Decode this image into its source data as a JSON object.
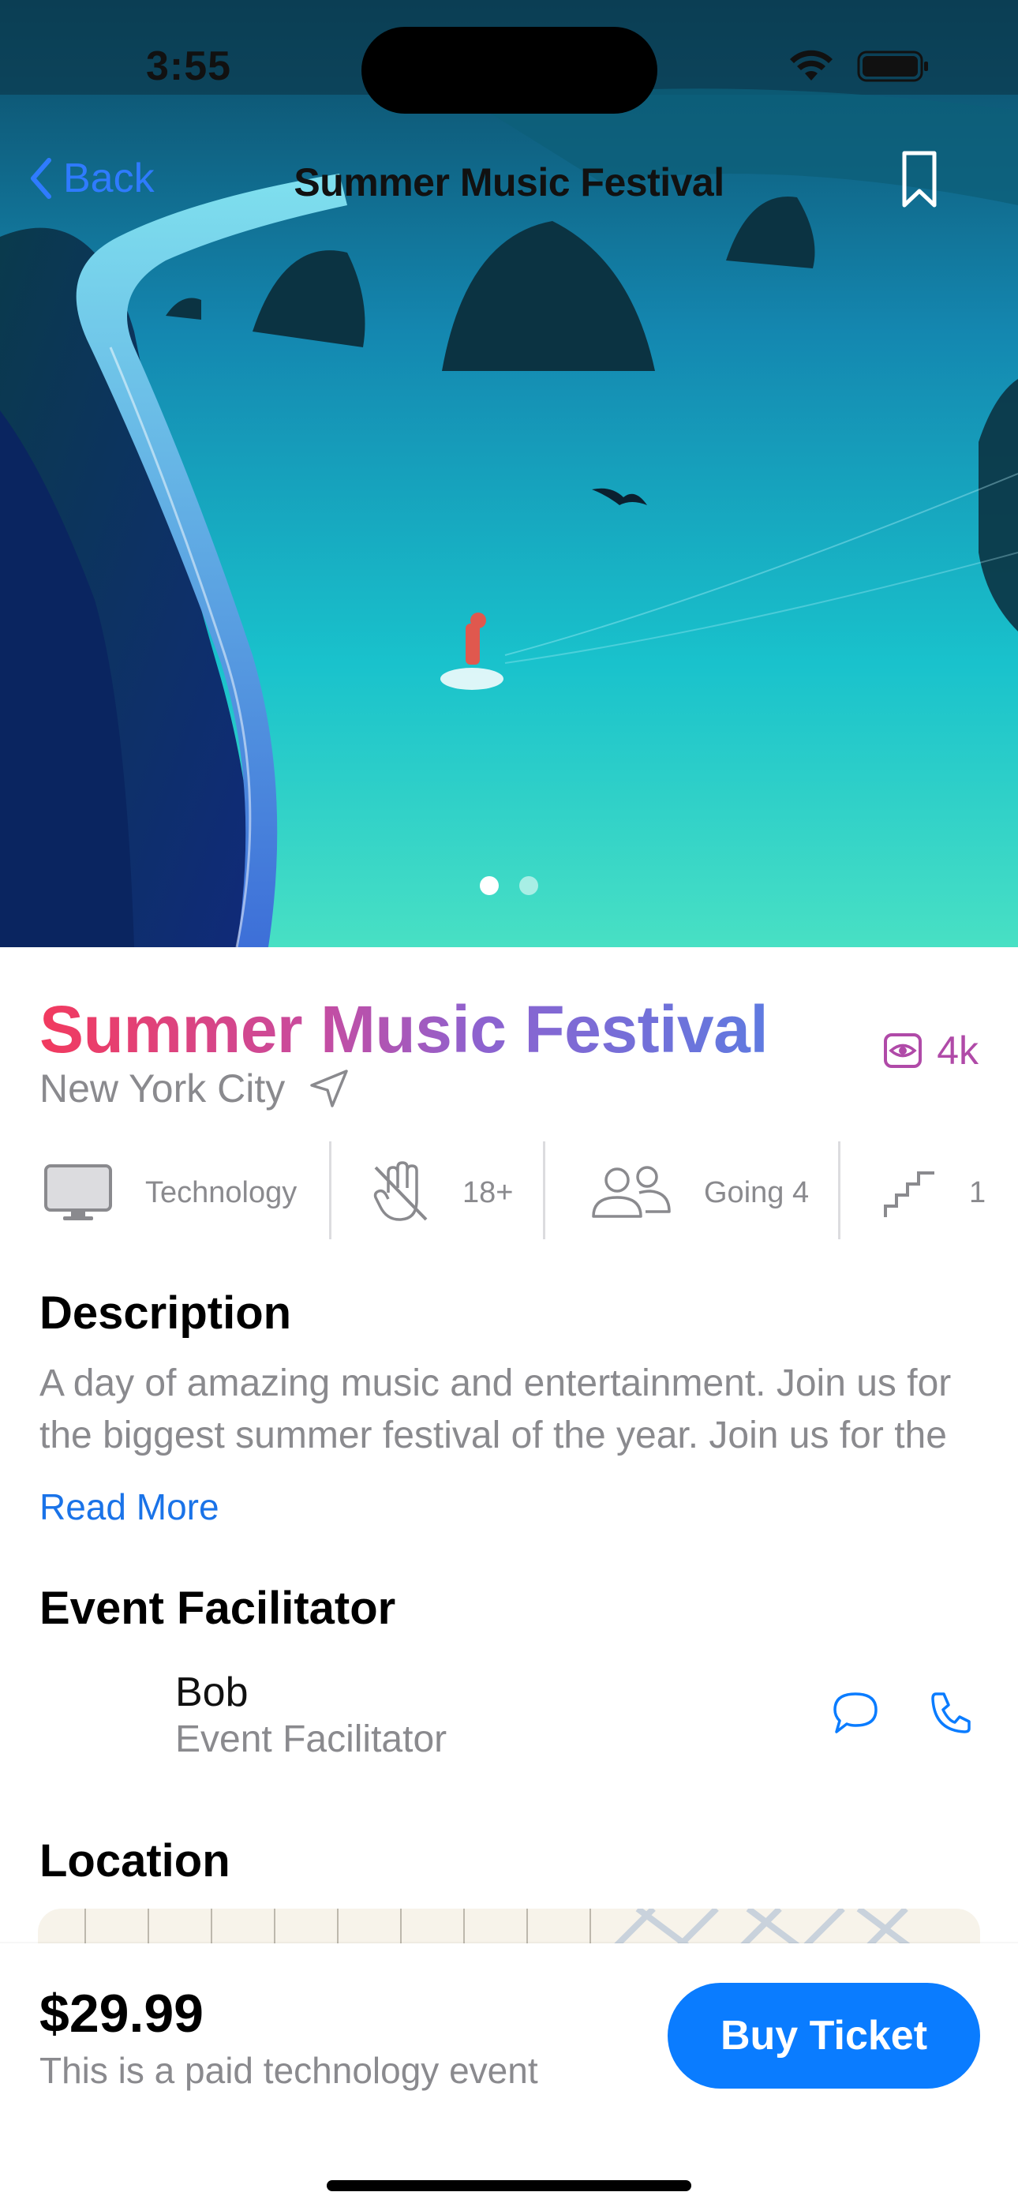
{
  "status_bar": {
    "time": "3:55"
  },
  "nav": {
    "back_label": "Back",
    "title": "Summer Music Festival"
  },
  "hero": {
    "page_count": 2,
    "active_page": 1
  },
  "event": {
    "title": "Summer Music Festival",
    "location": "New York City",
    "views": "4k",
    "tags": [
      {
        "icon": "monitor-icon",
        "label": "Technology"
      },
      {
        "icon": "no-touch-hand-icon",
        "label": "18+"
      },
      {
        "icon": "people-icon",
        "label": "Going 4"
      },
      {
        "icon": "stairs-icon",
        "label": "1"
      }
    ]
  },
  "description": {
    "heading": "Description",
    "text": "A day of amazing music and entertainment. Join us for the biggest summer festival of the year. Join us for the biggest summer festival of the year.",
    "read_more": "Read More"
  },
  "facilitator": {
    "heading": "Event Facilitator",
    "name": "Bob",
    "role": "Event Facilitator"
  },
  "location": {
    "heading": "Location"
  },
  "footer": {
    "price": "$29.99",
    "subtitle": "This is a paid technology event",
    "buy_label": "Buy Ticket"
  },
  "colors": {
    "accent": "#0a7cff",
    "title_gradient_start": "#f23a5e",
    "title_gradient_end": "#5f7ae0",
    "views_color": "#b04aa8",
    "secondary_text": "#8a8a8e"
  }
}
